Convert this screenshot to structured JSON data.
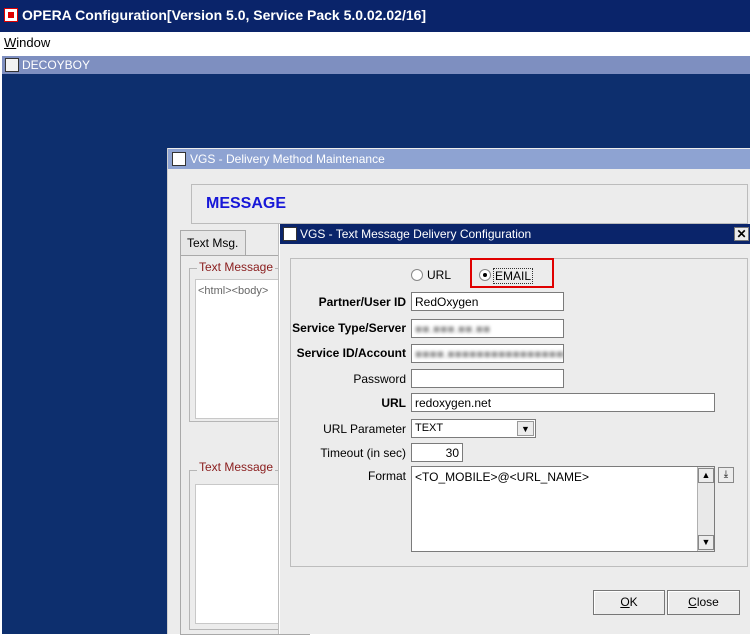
{
  "app": {
    "title": "OPERA Configuration[Version 5.0, Service Pack 5.0.02.02/16]",
    "menu": {
      "window_prefix": "W",
      "window_rest": "indow"
    }
  },
  "mdi": {
    "title": "DECOYBOY"
  },
  "delivery_method": {
    "title": "VGS - Delivery Method Maintenance",
    "heading": "MESSAGE",
    "tab_label": "Text Msg.",
    "group1_label": "Text Message",
    "group1_content": "<html><body>",
    "group2_label": "Text Message"
  },
  "config_dialog": {
    "title": "VGS - Text Message Delivery Configuration",
    "close_glyph": "✕",
    "radio_url_label": "URL",
    "radio_email_label": "EMAIL",
    "selected_method": "EMAIL",
    "fields": {
      "partner_label": "Partner/User ID",
      "partner_value": "RedOxygen",
      "service_type_label": "Service Type/Server",
      "service_type_value": "■■.■■■.■■.■■",
      "service_id_label": "Service ID/Account",
      "service_id_value": "■■■■.■■■■■■■■■■■■■■■■■■■",
      "password_label": "Password",
      "password_value": "",
      "url_label": "URL",
      "url_value": "redoxygen.net",
      "url_param_label": "URL Parameter",
      "url_param_value": "TEXT",
      "timeout_label": "Timeout (in sec)",
      "timeout_value": "30",
      "format_label": "Format",
      "format_value": "<TO_MOBILE>@<URL_NAME>"
    },
    "buttons": {
      "ok_prefix": "O",
      "ok_rest": "K",
      "close_prefix": "C",
      "close_rest": "lose"
    }
  },
  "colors": {
    "title_bar": "#0a246a",
    "workspace": "#0d2f6e",
    "heading": "#1717d8",
    "highlight": "#e00000"
  }
}
